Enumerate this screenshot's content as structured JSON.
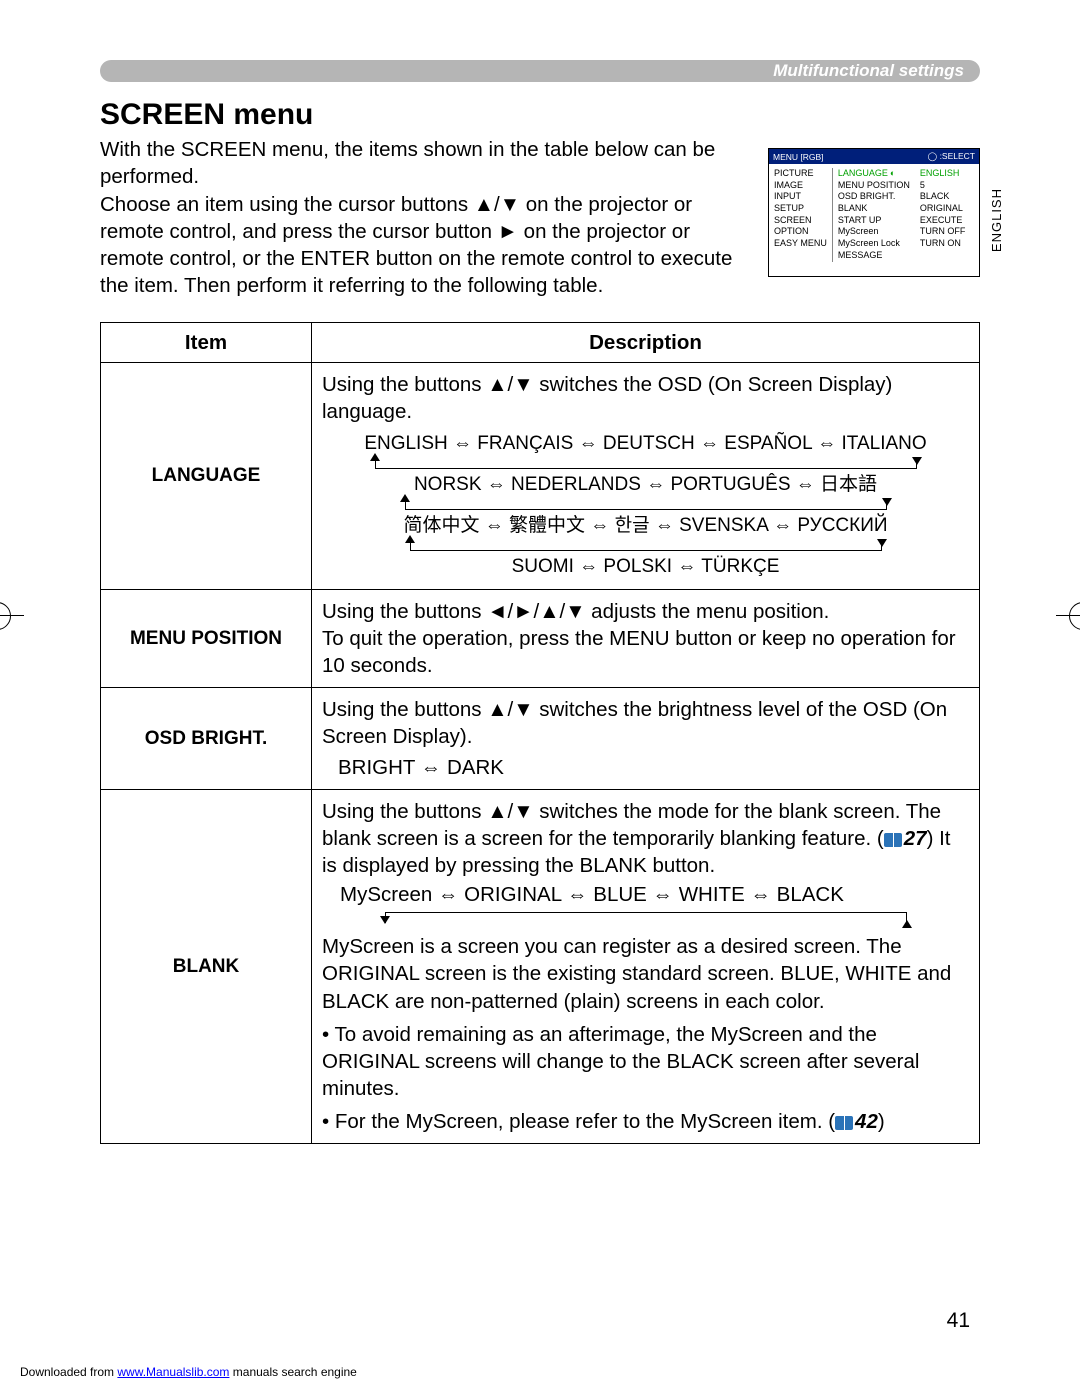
{
  "header": "Multifunctional settings",
  "title": "SCREEN menu",
  "intro": "With the SCREEN menu, the items shown in the table below can be performed.\nChoose an item using the cursor buttons ▲/▼ on the projector or remote control, and press the cursor button ► on the projector or remote control, or the ENTER button on the remote control to execute the item. Then perform it referring to the following table.",
  "sideLabel": "ENGLISH",
  "osd": {
    "head_left": "MENU [RGB]",
    "head_select_icon": "◯",
    "head_select": ":SELECT",
    "left_col": [
      "PICTURE",
      "IMAGE",
      "INPUT",
      "SETUP",
      "SCREEN",
      "OPTION",
      "EASY MENU"
    ],
    "mid_col": [
      "LANGUAGE",
      "MENU POSITION",
      "OSD BRIGHT.",
      "BLANK",
      "START UP",
      "MyScreen",
      "MyScreen Lock",
      "MESSAGE"
    ],
    "right_col": [
      "ENGLISH",
      "",
      "5",
      "BLACK",
      "ORIGINAL",
      "EXECUTE",
      "TURN OFF",
      "TURN ON"
    ],
    "lang_icon": "◐"
  },
  "table": {
    "headers": [
      "Item",
      "Description"
    ],
    "rows": [
      {
        "item": "LANGUAGE",
        "desc_intro": "Using the buttons ▲/▼ switches the OSD (On Screen Display) language.",
        "lang_lines": [
          "ENGLISH ⇔ FRANÇAIS ⇔ DEUTSCH ⇔ ESPAÑOL ⇔ ITALIANO",
          "NORSK ⇔ NEDERLANDS ⇔ PORTUGUÊS ⇔ 日本語",
          "简体中文 ⇔ 繁體中文 ⇔ 한글 ⇔ SVENSKA ⇔ РУССКИЙ",
          "SUOMI ⇔ POLSKI ⇔ TÜRKÇE"
        ]
      },
      {
        "item": "MENU POSITION",
        "desc": "Using the buttons ◄/►/▲/▼ adjusts the menu position.\nTo quit the operation, press the MENU button or keep no operation for 10 seconds."
      },
      {
        "item": "OSD BRIGHT.",
        "desc_line1": "Using the buttons ▲/▼ switches the brightness level of the OSD (On Screen Display).",
        "desc_line2": "BRIGHT ⇔ DARK"
      },
      {
        "item": "BLANK",
        "p1": "Using the buttons ▲/▼ switches the mode for the blank screen. The blank screen is a screen for the temporarily blanking feature. (",
        "ref1": "27",
        "p1b": ") It is displayed by pressing the BLANK button.",
        "options": "MyScreen ⇔ ORIGINAL ⇔ BLUE ⇔ WHITE ⇔ BLACK",
        "p2": "MyScreen is a screen you can register as a desired screen. The ORIGINAL screen is the existing standard screen. BLUE, WHITE and BLACK are non-patterned (plain) screens in each color.",
        "b1": "• To avoid remaining as an afterimage, the MyScreen and the ORIGINAL screens will change to the BLACK screen after several minutes.",
        "b2a": "• For the MyScreen, please refer to the MyScreen item. (",
        "ref2": "42",
        "b2b": ")"
      }
    ]
  },
  "pageNumber": "41",
  "footer": {
    "pre": "Downloaded from ",
    "link": "www.Manualslib.com",
    "post": " manuals search engine"
  }
}
